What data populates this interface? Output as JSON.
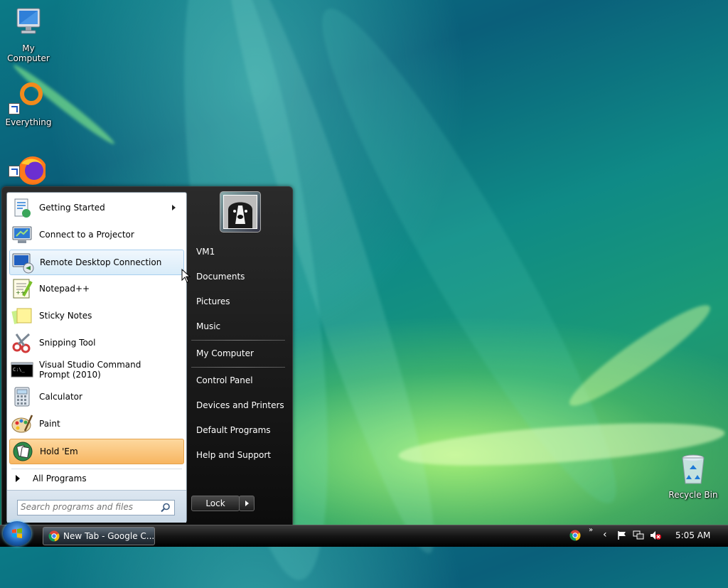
{
  "desktop": {
    "icons": [
      {
        "label": "My Computer",
        "icon": "computer-icon"
      },
      {
        "label": "Everything",
        "icon": "everything-search-icon"
      },
      {
        "label": "",
        "icon": "firefox-icon"
      },
      {
        "label": "Recycle Bin",
        "icon": "recycle-bin-icon"
      }
    ]
  },
  "start_menu": {
    "programs": [
      {
        "label": "Getting Started",
        "icon": "getting-started-icon",
        "has_submenu": true
      },
      {
        "label": "Connect to a Projector",
        "icon": "projector-icon"
      },
      {
        "label": "Remote Desktop Connection",
        "icon": "remote-desktop-icon",
        "state": "hover"
      },
      {
        "label": "Notepad++",
        "icon": "notepadpp-icon"
      },
      {
        "label": "Sticky Notes",
        "icon": "sticky-notes-icon"
      },
      {
        "label": "Snipping Tool",
        "icon": "scissors-icon"
      },
      {
        "label": "Visual Studio Command Prompt (2010)",
        "icon": "command-prompt-icon"
      },
      {
        "label": "Calculator",
        "icon": "calculator-icon"
      },
      {
        "label": "Paint",
        "icon": "paint-palette-icon"
      },
      {
        "label": "Hold 'Em",
        "icon": "hold-em-icon",
        "state": "highlighted"
      }
    ],
    "all_programs": "All Programs",
    "search_placeholder": "Search programs and files",
    "right_items": [
      "VM1",
      "Documents",
      "Pictures",
      "Music",
      "My Computer",
      "Control Panel",
      "Devices and Printers",
      "Default Programs",
      "Help and Support"
    ],
    "lock_label": "Lock"
  },
  "taskbar": {
    "window_button": "New Tab - Google C...",
    "clock": "5:05 AM",
    "tray_icons": [
      "chrome-tray-icon",
      "show-more-icon",
      "back-arrow-icon",
      "action-center-flag-icon",
      "network-icon",
      "volume-muted-icon"
    ]
  },
  "colors": {
    "hover_blue": "#d9ecf9",
    "pinned_orange": "#f7b661",
    "menu_dark": "#1c1c1c"
  }
}
